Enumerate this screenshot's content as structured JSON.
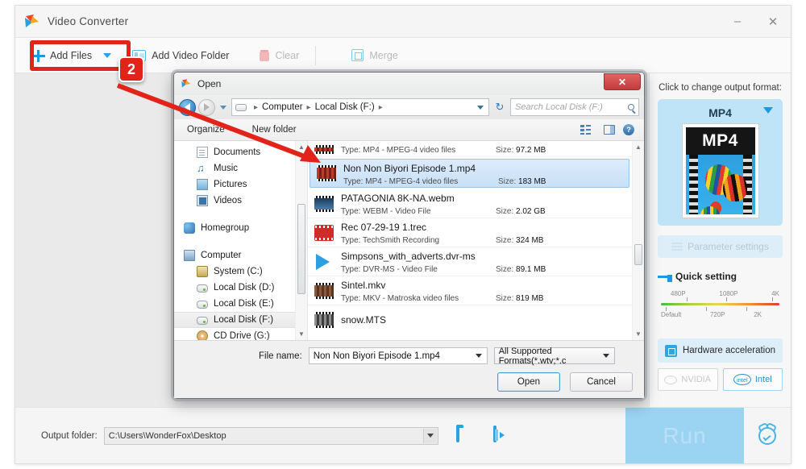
{
  "app": {
    "title": "Video Converter",
    "logo_icon": "wonderfox-play-logo",
    "window_controls": [
      {
        "name": "minimize",
        "glyph": "–"
      },
      {
        "name": "close",
        "glyph": "✕"
      }
    ]
  },
  "toolbar": {
    "add_files": {
      "label": "Add Files",
      "icon": "plus-icon"
    },
    "add_files_dropdown_icon": "caret-down-icon",
    "add_video_folder": {
      "label": "Add Video Folder",
      "icon": "folder-video-icon"
    },
    "clear": {
      "label": "Clear",
      "icon": "trash-icon",
      "disabled": true
    },
    "merge": {
      "label": "Merge",
      "icon": "merge-icon",
      "disabled": true
    }
  },
  "right_panel": {
    "output_format_label": "Click to change output format:",
    "format_name": "MP4",
    "format_thumb_text": "MP4",
    "parameter_settings": {
      "label": "Parameter settings",
      "disabled": true
    },
    "quick_setting": {
      "title": "Quick setting",
      "top_ticks": [
        "480P",
        "1080P",
        "4K"
      ],
      "bottom_ticks": [
        "Default",
        "720P",
        "2K"
      ],
      "gradient": [
        "#3fbf4a",
        "#a8cf3a",
        "#e8d94a",
        "#ef9a3a",
        "#e33b2c"
      ]
    },
    "hardware_acceleration": {
      "label": "Hardware acceleration"
    },
    "gpus": [
      {
        "label": "NVIDIA",
        "enabled": false
      },
      {
        "label": "Intel",
        "enabled": true,
        "badge": "intel"
      }
    ]
  },
  "bottom_bar": {
    "output_folder_label": "Output folder:",
    "output_folder_value": "C:\\Users\\WonderFox\\Desktop",
    "open_folder_icon": "folder-open-icon",
    "output_file_icon": "video-file-icon",
    "run_label": "Run",
    "alarm_icon": "alarm-clock-icon"
  },
  "dialog": {
    "title": "Open",
    "title_icon": "wonderfox-play-logo",
    "close_glyph": "✕",
    "nav": {
      "back_icon": "back-arrow-icon",
      "forward_icon": "forward-arrow-icon",
      "history_icon": "caret-down-icon",
      "breadcrumbs": [
        "Computer",
        "Local Disk (F:)"
      ],
      "refresh_icon": "refresh-icon",
      "search_placeholder": "Search Local Disk (F:)",
      "search_icon": "magnifier-icon"
    },
    "commandbar": {
      "organize": "Organize",
      "new_folder": "New folder",
      "view_icon": "view-list-icon",
      "preview_pane_icon": "preview-pane-icon",
      "help_icon": "help-icon"
    },
    "sidebar": [
      {
        "label": "Documents",
        "icon": "document-icon",
        "kind": "child"
      },
      {
        "label": "Music",
        "icon": "music-icon",
        "kind": "child"
      },
      {
        "label": "Pictures",
        "icon": "picture-icon",
        "kind": "child"
      },
      {
        "label": "Videos",
        "icon": "video-icon",
        "kind": "child"
      },
      {
        "label": "",
        "icon": "",
        "kind": "gap"
      },
      {
        "label": "Homegroup",
        "icon": "homegroup-icon",
        "kind": "root"
      },
      {
        "label": "",
        "icon": "",
        "kind": "gap"
      },
      {
        "label": "Computer",
        "icon": "computer-icon",
        "kind": "root"
      },
      {
        "label": "System (C:)",
        "icon": "system-drive-icon",
        "kind": "child"
      },
      {
        "label": "Local Disk (D:)",
        "icon": "disk-icon",
        "kind": "child"
      },
      {
        "label": "Local Disk (E:)",
        "icon": "disk-icon",
        "kind": "child"
      },
      {
        "label": "Local Disk (F:)",
        "icon": "disk-icon",
        "kind": "child",
        "selected": true
      },
      {
        "label": "CD Drive (G:)",
        "icon": "cd-icon",
        "kind": "child"
      }
    ],
    "files": [
      {
        "name": "",
        "type": "Type: MP4 - MPEG-4 video files",
        "size_label": "Size:",
        "size": "97.2 MB",
        "icon": "film-red-icon",
        "partial": true
      },
      {
        "name": "Non Non Biyori Episode 1.mp4",
        "type": "Type: MP4 - MPEG-4 video files",
        "size_label": "Size:",
        "size": "183 MB",
        "icon": "film-red-icon",
        "selected": true
      },
      {
        "name": "PATAGONIA 8K-NA.webm",
        "type": "Type: WEBM - Video File",
        "size_label": "Size:",
        "size": "2.02 GB",
        "icon": "film-blue-icon"
      },
      {
        "name": "Rec 07-29-19 1.trec",
        "type": "Type: TechSmith Recording",
        "size_label": "Size:",
        "size": "324 MB",
        "icon": "trec-icon"
      },
      {
        "name": "Simpsons_with_adverts.dvr-ms",
        "type": "Type: DVR-MS - Video File",
        "size_label": "Size:",
        "size": "89.1 MB",
        "icon": "play-triangle-icon"
      },
      {
        "name": "Sintel.mkv",
        "type": "Type: MKV - Matroska video files",
        "size_label": "Size:",
        "size": "819 MB",
        "icon": "film-brown-icon"
      },
      {
        "name": "snow.MTS",
        "type": "",
        "size_label": "",
        "size": "",
        "icon": "film-gray-icon"
      }
    ],
    "footer": {
      "file_name_label": "File name:",
      "file_name_value": "Non Non Biyori Episode 1.mp4",
      "file_type_value": "All Supported Formats(*.wtv;*.c",
      "open_button": "Open",
      "cancel_button": "Cancel"
    }
  },
  "annotation": {
    "step_number": "2",
    "highlight_color": "#e2231a"
  }
}
